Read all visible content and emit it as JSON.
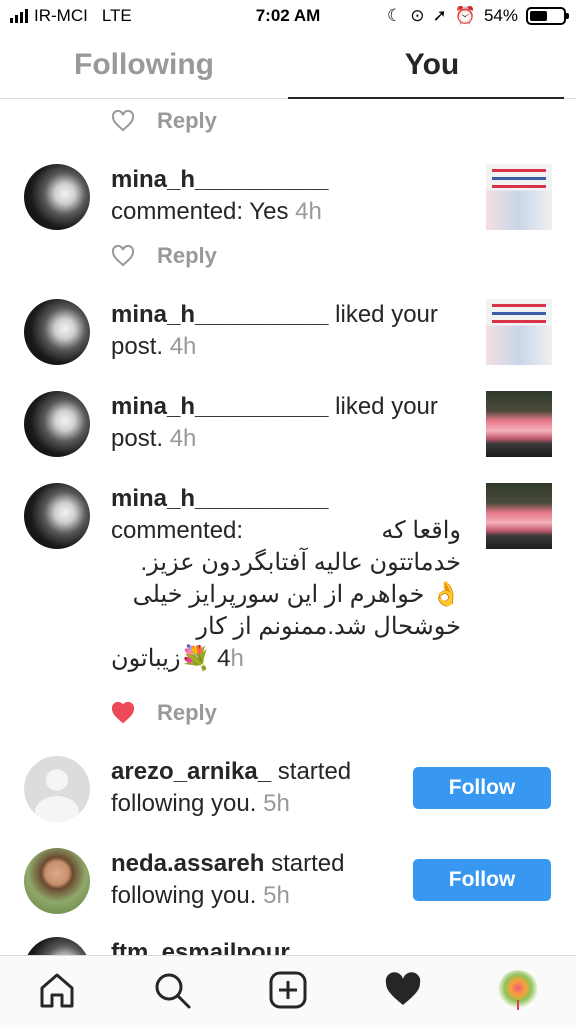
{
  "status_bar": {
    "carrier": "IR-MCI",
    "network": "LTE",
    "time": "7:02 AM",
    "battery_percent": "54%",
    "battery_level": 0.54
  },
  "tabs": [
    {
      "label": "Following",
      "selected": false
    },
    {
      "label": "You",
      "selected": true
    }
  ],
  "reply_label": "Reply",
  "items": [
    {
      "type": "comment",
      "username": "mina_h__________",
      "text": "commented: Yes",
      "time": "4h"
    },
    {
      "type": "like",
      "username": "mina_h__________",
      "text": "liked your post.",
      "time": "4h"
    },
    {
      "type": "like",
      "username": "mina_h__________",
      "text": "liked your post.",
      "time": "4h"
    },
    {
      "type": "comment",
      "username": "mina_h__________",
      "prefix": "commented:",
      "comment_lines": [
        "واقعا که",
        "خدماتتون عالیه آفتابگردون عزیز.",
        "👌 خواهرم از این سورپرایز خیلی",
        "خوشحال شد.ممنونم از کار",
        "4 💐زیباتون"
      ],
      "time_tail": "h"
    },
    {
      "type": "follow",
      "username": "arezo_arnika_",
      "text": "started following you.",
      "time": "5h",
      "button": "Follow"
    },
    {
      "type": "follow",
      "username": "neda.assareh",
      "text": "started following you.",
      "time": "5h",
      "button": "Follow"
    },
    {
      "type": "partial",
      "username": "ftm_esmailpour"
    }
  ],
  "icons": {
    "home": "home-icon",
    "search": "search-icon",
    "add": "add-post-icon",
    "activity": "heart-icon",
    "profile": "profile-avatar"
  },
  "colors": {
    "follow_button": "#3897f0",
    "liked_heart": "#ed4956",
    "muted_text": "#999999"
  }
}
